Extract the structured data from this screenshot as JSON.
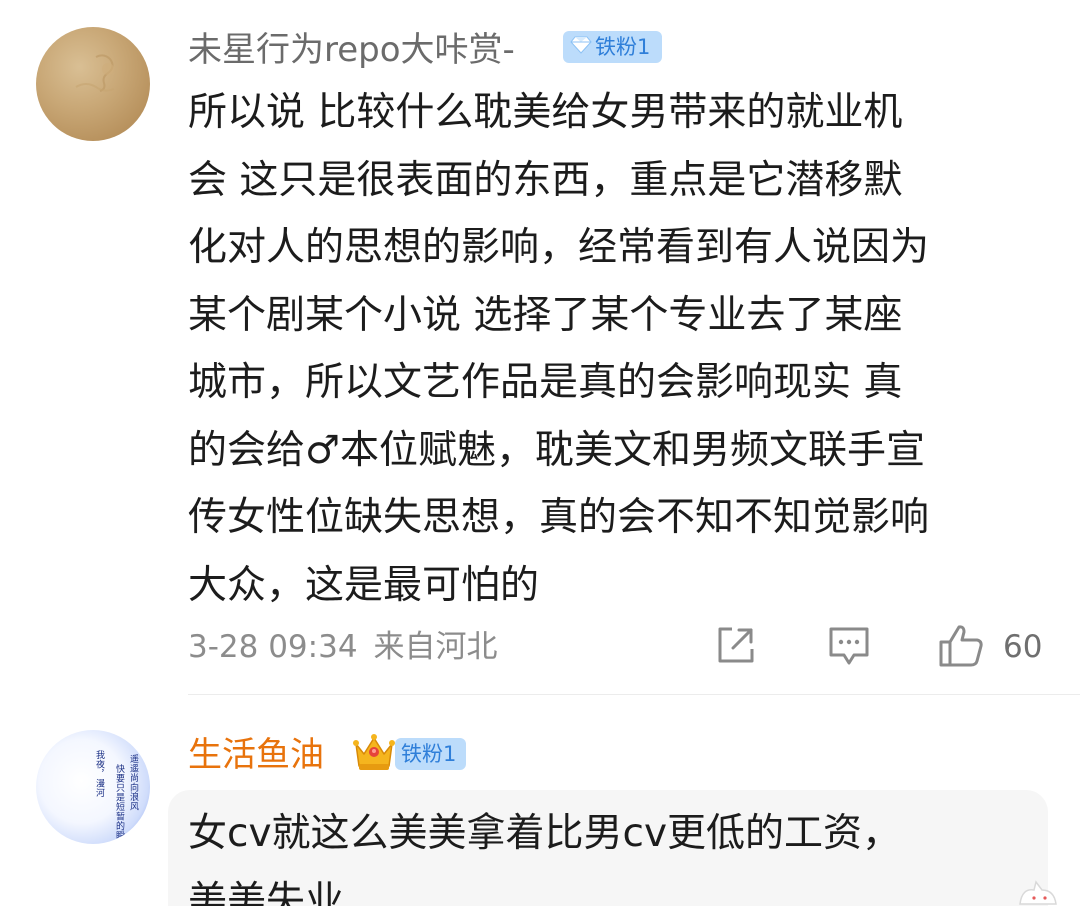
{
  "comments": [
    {
      "username": "未星行为repo大咔赏-",
      "badge": "铁粉1",
      "text_lines": [
        "所以说 比较什么耽美给女男带来的就业机",
        "会 这只是很表面的东西，重点是它潜移默",
        "化对人的思想的影响，经常看到有人说因为",
        "某个剧某个小说 选择了某个专业去了某座",
        "城市，所以文艺作品是真的会影响现实 真",
        "的会给♂本位赋魅，耽美文和男频文联手宣",
        "传女性位缺失思想，真的会不知不知觉影响",
        "大众，这是最可怕的"
      ],
      "date": "3-28 09:34",
      "location": "来自河北",
      "like_count": "60"
    },
    {
      "username": "生活鱼油",
      "badge": "铁粉1",
      "avatar_text": [
        "遥遥尚向浪风",
        "快要只是短暂的瞬",
        "我夜，漫河"
      ],
      "text_lines": [
        "女cv就这么美美拿着比男cv更低的工资，",
        "美美失业"
      ]
    }
  ],
  "icons": {
    "badge_diamond": "diamond-icon",
    "badge_crown": "crown-icon",
    "share": "share-icon",
    "comment": "comment-icon",
    "like": "thumbs-up-icon"
  },
  "colors": {
    "username_gray": "#6b6b6b",
    "username_orange": "#e8730c",
    "badge_bg": "#bcdcfb",
    "badge_text": "#2f7fd9",
    "meta_gray": "#8c8c8c"
  }
}
